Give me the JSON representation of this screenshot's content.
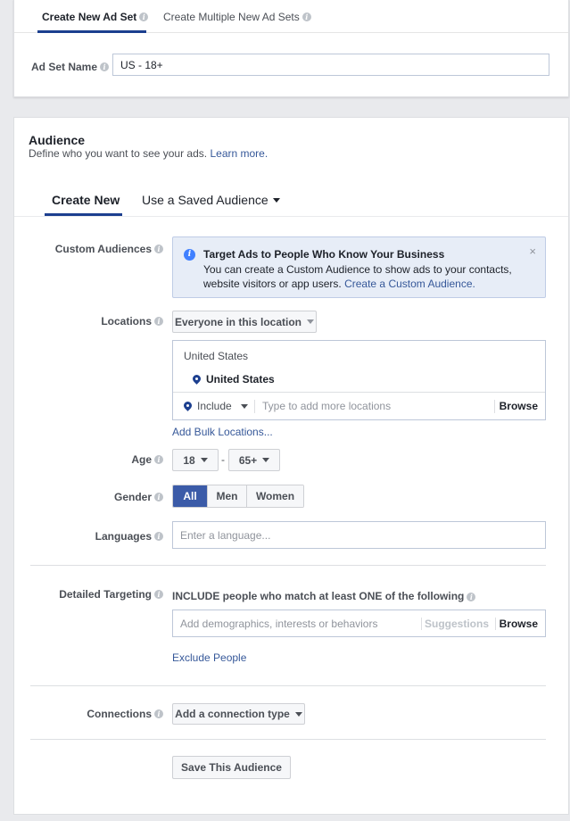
{
  "top_tabs": [
    {
      "label": "Create New Ad Set",
      "active": true
    },
    {
      "label": "Create Multiple New Ad Sets",
      "active": false
    }
  ],
  "ad_set_name": {
    "label": "Ad Set Name",
    "value": "US - 18+"
  },
  "audience": {
    "title": "Audience",
    "subtitle": "Define who you want to see your ads.",
    "learn_more": "Learn more.",
    "tabs": [
      {
        "label": "Create New",
        "active": true
      },
      {
        "label": "Use a Saved Audience",
        "active": false
      }
    ]
  },
  "custom_audiences": {
    "label": "Custom Audiences",
    "notice": {
      "title": "Target Ads to People Who Know Your Business",
      "body": "You can create a Custom Audience to show ads to your contacts, website visitors or app users.",
      "link": "Create a Custom Audience.",
      "close": "×"
    }
  },
  "locations": {
    "label": "Locations",
    "dropdown": "Everyone in this location",
    "country_header": "United States",
    "selected": "United States",
    "include": "Include",
    "placeholder": "Type to add more locations",
    "browse": "Browse",
    "bulk_link": "Add Bulk Locations..."
  },
  "age": {
    "label": "Age",
    "min": "18",
    "separator": "-",
    "max": "65+"
  },
  "gender": {
    "label": "Gender",
    "options": [
      "All",
      "Men",
      "Women"
    ],
    "selected": "All"
  },
  "languages": {
    "label": "Languages",
    "placeholder": "Enter a language..."
  },
  "detailed_targeting": {
    "label": "Detailed Targeting",
    "header": "INCLUDE people who match at least ONE of the following",
    "placeholder": "Add demographics, interests or behaviors",
    "suggestions": "Suggestions",
    "browse": "Browse",
    "exclude_link": "Exclude People"
  },
  "connections": {
    "label": "Connections",
    "dropdown": "Add a connection type"
  },
  "save_button": "Save This Audience",
  "colors": {
    "accent": "#1c3f8f",
    "link": "#365899",
    "selected": "#3b5ba8",
    "notice_bg": "#e7edf7"
  }
}
